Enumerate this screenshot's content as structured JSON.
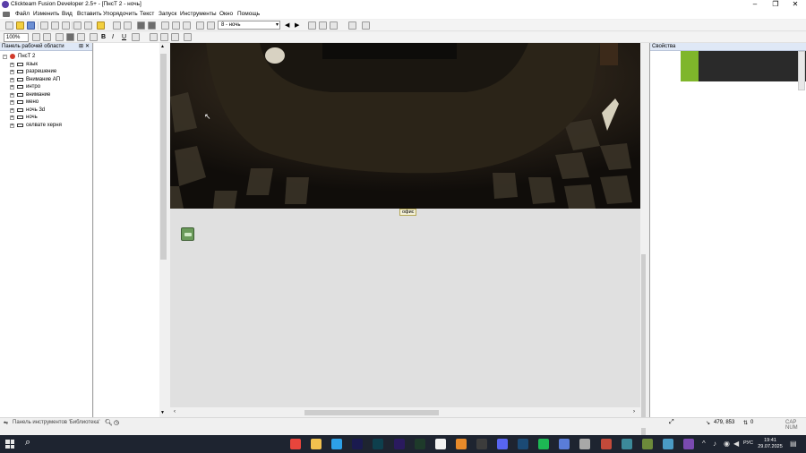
{
  "window": {
    "title": "Clickteam Fusion Developer 2.5+ - [ПнсТ 2 - ночь]",
    "controls": [
      "–",
      "❐",
      "✕"
    ]
  },
  "menu": [
    "Файл",
    "Изменить",
    "Вид",
    "Вставить",
    "Упорядочить",
    "Текст",
    "Запуск",
    "Инструменты",
    "Окно",
    "Помощь"
  ],
  "doc_controls": "– ❐ ✕",
  "toolbar": {
    "frame_select": "8 - ночь",
    "zoom_select": "100%"
  },
  "workspace": {
    "title": "Панель рабочей области",
    "root": "ПнсТ 2",
    "frames": [
      "язык",
      "разрешение",
      "Внимание АП",
      "интро",
      "внимание",
      "мено",
      "ночь 3d",
      "ночь",
      "селвате херня"
    ]
  },
  "frame_editor": {
    "frame_label": "офис"
  },
  "properties": {
    "title": "Свойства"
  },
  "bottom": {
    "library_label": "Панель инструментов 'Библиотека'",
    "coords": "479, 853",
    "zero": "0",
    "caps": "CAP NUM"
  },
  "taskbar": {
    "lang": "РУС",
    "time": "19:41",
    "date": "29.07.2025",
    "apps": [
      {
        "name": "chrome-icon",
        "color": "#e8453c"
      },
      {
        "name": "explorer-icon",
        "color": "#f2c14e"
      },
      {
        "name": "photoshop-icon",
        "color": "#2da1e8"
      },
      {
        "name": "after-effects-icon",
        "color": "#1a1a4f"
      },
      {
        "name": "audition-icon",
        "color": "#0e3f4d"
      },
      {
        "name": "premiere-icon",
        "color": "#2a1a5e"
      },
      {
        "name": "photoshop-2-icon",
        "color": "#1e3a2a"
      },
      {
        "name": "github-icon",
        "color": "#f2f2f2"
      },
      {
        "name": "blender-icon",
        "color": "#e88a2a"
      },
      {
        "name": "terminal-icon",
        "color": "#3c3c3c"
      },
      {
        "name": "discord-icon",
        "color": "#5865f2"
      },
      {
        "name": "steam-icon",
        "color": "#1b4a75"
      },
      {
        "name": "spotify-icon",
        "color": "#1db954"
      },
      {
        "name": "discord-2-icon",
        "color": "#5a7dd8"
      },
      {
        "name": "app-icon-a",
        "color": "#a8a8a8"
      },
      {
        "name": "app-icon-b",
        "color": "#c44a3a"
      },
      {
        "name": "app-icon-c",
        "color": "#3c8a9a"
      },
      {
        "name": "app-icon-d",
        "color": "#6c8a3a"
      },
      {
        "name": "app-icon-e",
        "color": "#4a9ac4"
      },
      {
        "name": "app-icon-f",
        "color": "#7a4ab0"
      }
    ]
  }
}
